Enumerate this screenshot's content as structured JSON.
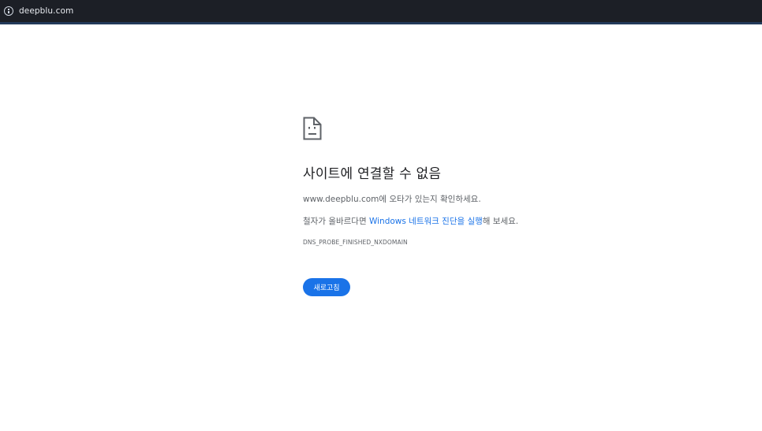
{
  "address_bar": {
    "url": "deepblu.com",
    "icon": "info-icon"
  },
  "error": {
    "icon": "sad-page-icon",
    "title": "사이트에 연결할 수 없음",
    "host_line": "www.deepblu.com에 오타가 있는지 확인하세요.",
    "spelling_prefix": "철자가 올바르다면 ",
    "diagnostics_link": "Windows 네트워크 진단을 실행",
    "spelling_suffix": "해 보세요.",
    "code": "DNS_PROBE_FINISHED_NXDOMAIN",
    "reload_label": "새로고침"
  },
  "colors": {
    "topbar": "#1c1f26",
    "accent": "#1a73e8",
    "text_primary": "#202124",
    "text_secondary": "#5f6368"
  }
}
